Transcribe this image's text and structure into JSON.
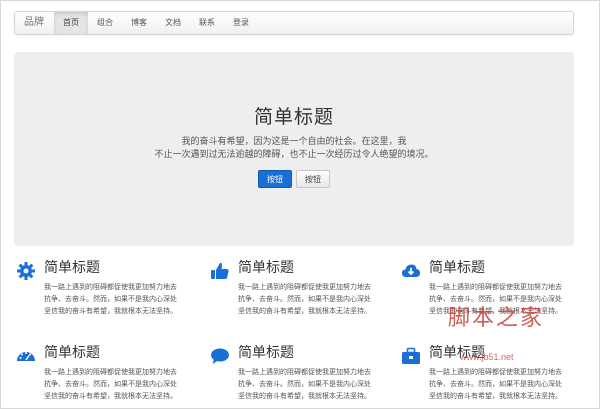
{
  "navbar": {
    "brand": "品牌",
    "items": [
      {
        "label": "首页",
        "active": true
      },
      {
        "label": "组合",
        "active": false
      },
      {
        "label": "博客",
        "active": false
      },
      {
        "label": "文档",
        "active": false
      },
      {
        "label": "联系",
        "active": false
      },
      {
        "label": "登录",
        "active": false
      }
    ]
  },
  "hero": {
    "title": "简单标题",
    "line1": "我的奋斗有希望，因为这是一个自由的社会。在这里，我",
    "line2": "不止一次遇到过无法逾越的障碍，也不止一次经历过令人绝望的境况。",
    "primary_button": "按钮",
    "default_button": "按钮"
  },
  "features": [
    {
      "icon": "gear-icon",
      "title": "简单标题",
      "desc": [
        "我一路上遇到的阻碍都促使我更加努力地去",
        "抗争、去奋斗。然而，如果不是我内心深处",
        "坚信我的奋斗有希望，我就根本无法坚持。"
      ]
    },
    {
      "icon": "thumbs-up-icon",
      "title": "简单标题",
      "desc": [
        "我一路上遇到的阻碍都促使我更加努力地去",
        "抗争、去奋斗。然而，如果不是我内心深处",
        "坚信我的奋斗有希望，我就根本无法坚持。"
      ]
    },
    {
      "icon": "cloud-download-icon",
      "title": "简单标题",
      "desc": [
        "我一路上遇到的阻碍都促使我更加努力地去",
        "抗争、去奋斗。然而，如果不是我内心深处",
        "坚信我的奋斗有希望，我就根本无法坚持。"
      ]
    },
    {
      "icon": "dashboard-icon",
      "title": "简单标题",
      "desc": [
        "我一路上遇到的阻碍都促使我更加努力地去",
        "抗争、去奋斗。然而，如果不是我内心深处",
        "坚信我的奋斗有希望，我就根本无法坚持。"
      ]
    },
    {
      "icon": "comment-icon",
      "title": "简单标题",
      "desc": [
        "我一路上遇到的阻碍都促使我更加努力地去",
        "抗争、去奋斗。然而，如果不是我内心深处",
        "坚信我的奋斗有希望，我就根本无法坚持。"
      ]
    },
    {
      "icon": "briefcase-icon",
      "title": "简单标题",
      "desc": [
        "我一路上遇到的阻碍都促使我更加努力地去",
        "抗争、去奋斗。然而，如果不是我内心深处",
        "坚信我的奋斗有希望，我就根本无法坚持。"
      ]
    }
  ],
  "watermark": {
    "title": "脚本之家",
    "url": "www.jb51.net"
  },
  "colors": {
    "accent": "#1a6fd6",
    "icon": "#1a6fd6",
    "hero_bg": "#eeeeee"
  }
}
